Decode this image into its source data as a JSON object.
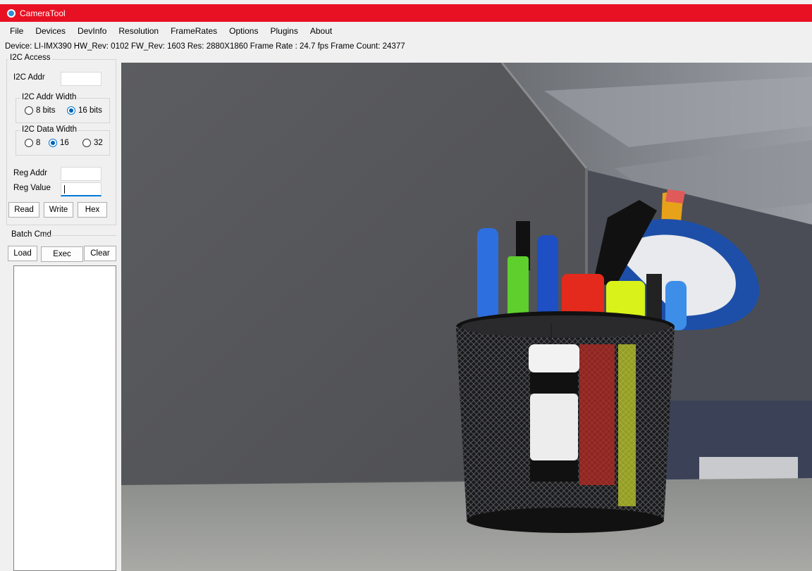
{
  "window": {
    "title": "CameraTool",
    "icon": "camera-app-icon"
  },
  "menu": [
    "File",
    "Devices",
    "DevInfo",
    "Resolution",
    "FrameRates",
    "Options",
    "Plugins",
    "About"
  ],
  "device_info": "Device:  LI-IMX390  HW_Rev:  0102  FW_Rev:  1603  Res:  2880X1860  Frame Rate :  24.7 fps  Frame Count:  24377",
  "i2c": {
    "group_label": "I2C Access",
    "addr_label": "I2C Addr",
    "addr_value": "",
    "addr_width": {
      "label": "I2C Addr Width",
      "options": [
        "8 bits",
        "16 bits"
      ],
      "selected": "16 bits"
    },
    "data_width": {
      "label": "I2C Data Width",
      "options": [
        "8",
        "16",
        "32"
      ],
      "selected": "16"
    },
    "reg_addr_label": "Reg Addr",
    "reg_addr_value": "",
    "reg_value_label": "Reg Value",
    "reg_value_value": "",
    "buttons": {
      "read": "Read",
      "write": "Write",
      "hex": "Hex"
    }
  },
  "batch": {
    "group_label": "Batch Cmd",
    "buttons": {
      "load": "Load",
      "exec": "Exec",
      "clear": "Clear"
    }
  },
  "colors": {
    "titlebar": "#e81123",
    "accent": "#0078d7"
  }
}
